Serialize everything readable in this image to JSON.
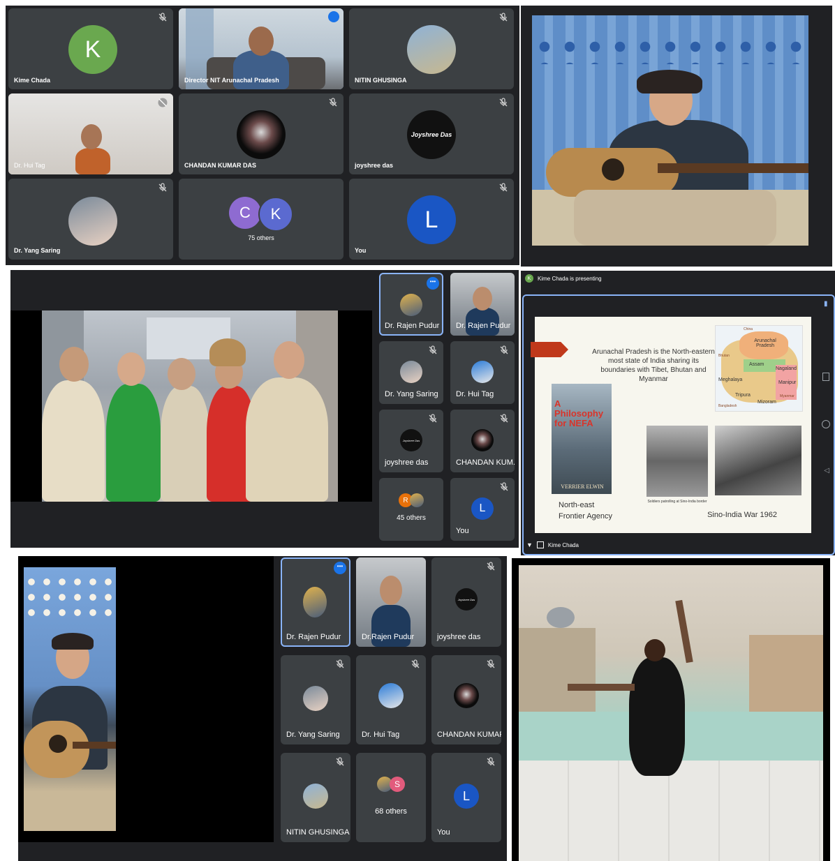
{
  "panel1": {
    "tiles": [
      {
        "name": "Kime Chada",
        "initial": "K"
      },
      {
        "name": "Director NIT Arunachal Pradesh"
      },
      {
        "name": "NITIN GHUSINGA"
      },
      {
        "name": "Dr. Hui Tag"
      },
      {
        "name": "CHANDAN KUMAR DAS"
      },
      {
        "name": "joyshree das",
        "avatar_text": "Joyshree Das"
      },
      {
        "name": "Dr. Yang Saring"
      },
      {
        "name": "75 others",
        "initials": [
          "C",
          "K"
        ]
      },
      {
        "name": "You",
        "initial": "L"
      }
    ]
  },
  "panel3": {
    "tiles": [
      {
        "name": "Dr. Rajen Pudur"
      },
      {
        "name": "Dr. Rajen Pudur"
      },
      {
        "name": "Dr. Yang Saring"
      },
      {
        "name": "Dr. Hui Tag"
      },
      {
        "name": "joyshree das",
        "avatar_text": "Joyshree Das"
      },
      {
        "name": "CHANDAN KUM..."
      },
      {
        "name": "45 others",
        "initials": [
          "R"
        ]
      },
      {
        "name": "You",
        "initial": "L"
      }
    ],
    "more_dots": "•••"
  },
  "panel4": {
    "presenting": "Kime Chada is presenting",
    "presenter_initial": "K",
    "footer_name": "Kime Chada",
    "slide": {
      "heading": "Arunachal Pradesh is the North-eastern most state of India sharing its boundaries with Tibet, Bhutan and Myanmar",
      "book_title_1": "A Philosophy",
      "book_title_2": "for NEFA",
      "book_author": "VERRIER ELWIN",
      "caption_book": "North-east Frontier Agency",
      "caption_photo": "Soldiers patrolling at Sino-India border",
      "caption_war": "Sino-India War 1962",
      "map_labels": [
        "Arunachal Pradesh",
        "Assam",
        "Nagaland",
        "Meghalaya",
        "Manipur",
        "Tripura",
        "Mizoram",
        "Bhutan",
        "China",
        "Bangladesh",
        "Myanmar"
      ]
    }
  },
  "panel5": {
    "tiles": [
      {
        "name": "Dr. Rajen Pudur"
      },
      {
        "name": "Dr.Rajen Pudur"
      },
      {
        "name": "joyshree das",
        "avatar_text": "Joyshree Das"
      },
      {
        "name": "Dr. Yang Saring"
      },
      {
        "name": "Dr. Hui Tag"
      },
      {
        "name": "CHANDAN KUMAR ..."
      },
      {
        "name": "NITIN GHUSINGA"
      },
      {
        "name": "68 others",
        "initials": [
          "S"
        ]
      },
      {
        "name": "You",
        "initial": "L"
      }
    ],
    "more_dots": "•••"
  },
  "colors": {
    "meet_bg": "#202124",
    "tile_bg": "#3c4043",
    "accent_blue": "#8ab4f8",
    "avatar_green": "#6aa84f",
    "avatar_blue": "#1a56c4",
    "avatar_purple": "#8e6bd1",
    "avatar_indigo": "#5b6ad0",
    "avatar_orange": "#e8710a",
    "avatar_pink": "#e25b7c"
  }
}
